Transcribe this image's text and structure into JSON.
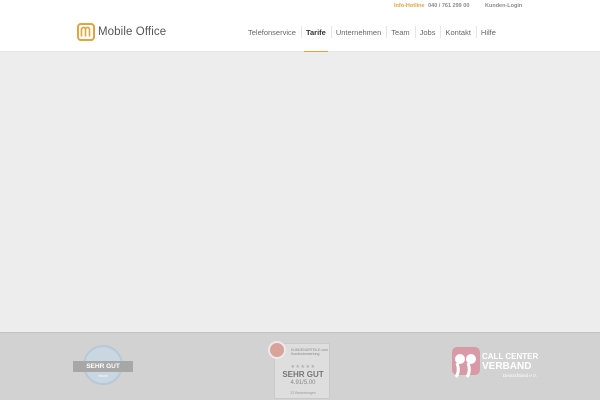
{
  "topbar": {
    "hotline_label": "Info-Hotline",
    "hotline_number": "040 / 761 299 00",
    "login_label": "Kunden-Login"
  },
  "logo": {
    "name": "Mobile Office",
    "icon": "logo-m-icon"
  },
  "nav": {
    "items": [
      {
        "label": "Telefonservice"
      },
      {
        "label": "Tarife"
      },
      {
        "label": "Unternehmen"
      },
      {
        "label": "Team"
      },
      {
        "label": "Jobs"
      },
      {
        "label": "Kontakt"
      },
      {
        "label": "Hilfe"
      }
    ],
    "active": "Tarife"
  },
  "footer": {
    "badge1": {
      "label": "SEHR GUT",
      "sub": "ekomi"
    },
    "badge2": {
      "org": "KUNDENURTEILE.com Kundenbewertung",
      "stars": "★★★★★",
      "grade": "SEHR GUT",
      "score": "4.91/5.00",
      "reviews": "22 Bewertungen"
    },
    "badge3": {
      "line1": "CALL CENTER",
      "line2": "VERBAND",
      "line3": "Deutschland e.V."
    }
  },
  "colors": {
    "accent": "#e8a23a",
    "content_bg": "#ededed",
    "footer_bg": "#d2d2d2",
    "quote_pink": "#d99aa7"
  }
}
